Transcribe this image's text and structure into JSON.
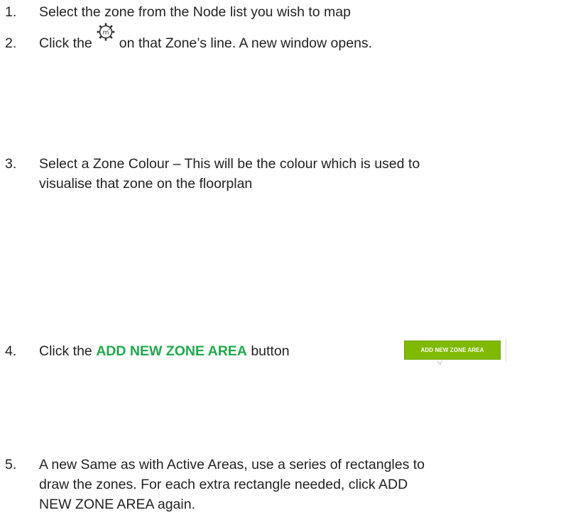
{
  "steps": [
    {
      "number": "1.",
      "line1": "Select the zone from the Node list you wish to map"
    },
    {
      "number": "2.",
      "before_icon": "Click the",
      "icon": "gear-m2-icon",
      "after_icon": "on that Zone’s line. A new window opens."
    },
    {
      "number": "3.",
      "line1": "Select a Zone Colour – This will be the colour which is used to",
      "line2": "visualise that zone on the floorplan"
    },
    {
      "number": "4.",
      "before_highlight": "Click the",
      "highlight": "ADD NEW ZONE AREA",
      "after_highlight": "button"
    },
    {
      "number": "5.",
      "line1": "A new Same as with Active Areas, use a series of rectangles to",
      "line2": "draw the zones. For each extra rectangle needed, click ADD",
      "line3": "NEW ZONE AREA again."
    }
  ],
  "zone_button": {
    "label": "ADD NEW ZONE AREA"
  },
  "colors": {
    "highlight_text": "#1faa4a",
    "button_bg": "#7fba00",
    "text": "#222222"
  }
}
